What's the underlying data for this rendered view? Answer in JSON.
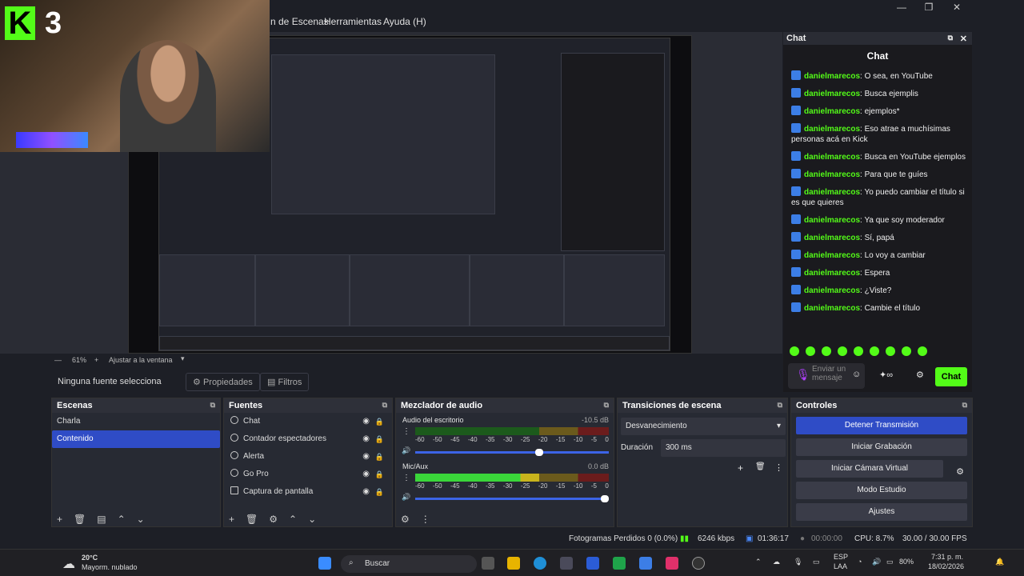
{
  "menubar": {
    "items": [
      "n de Escenas",
      "Herramientas",
      "Ayuda (H)"
    ],
    "minimize": "—",
    "maximize": "❐",
    "close": "✕"
  },
  "webcam": {
    "logo": "K",
    "number": "3"
  },
  "preview": {
    "zoom_minus": "—",
    "zoom_value": "61%",
    "zoom_plus": "+",
    "zoom_fit": "Ajustar a la ventana"
  },
  "source_bar": {
    "no_source": "Ninguna fuente selecciona",
    "properties": "Propiedades",
    "filters": "Filtros"
  },
  "chat": {
    "dock_title": "Chat",
    "title": "Chat",
    "messages": [
      {
        "user": "danielmarecos",
        "text": "O sea, en YouTube"
      },
      {
        "user": "danielmarecos",
        "text": "Busca ejemplis"
      },
      {
        "user": "danielmarecos",
        "text": "ejemplos*"
      },
      {
        "user": "danielmarecos",
        "text": "Eso atrae a muchísimas personas acá en Kick"
      },
      {
        "user": "danielmarecos",
        "text": "Busca en YouTube ejemplos"
      },
      {
        "user": "danielmarecos",
        "text": "Para que te guíes"
      },
      {
        "user": "danielmarecos",
        "text": "Yo puedo cambiar el título si es que quieres"
      },
      {
        "user": "danielmarecos",
        "text": "Ya que soy moderador"
      },
      {
        "user": "danielmarecos",
        "text": "Sí, papá"
      },
      {
        "user": "danielmarecos",
        "text": "Lo voy a cambiar"
      },
      {
        "user": "danielmarecos",
        "text": "Espera"
      },
      {
        "user": "danielmarecos",
        "text": "¿Viste?"
      },
      {
        "user": "danielmarecos",
        "text": "Cambie el título"
      }
    ],
    "input_placeholder": "Enviar un mensaje",
    "send_label": "Chat"
  },
  "scenes": {
    "title": "Escenas",
    "items": [
      "Charla",
      "Contenido"
    ],
    "selected": "Contenido"
  },
  "sources": {
    "title": "Fuentes",
    "items": [
      "Chat",
      "Contador espectadores",
      "Alerta",
      "Go Pro",
      "Captura de pantalla"
    ]
  },
  "mixer": {
    "title": "Mezclador de audio",
    "channels": [
      {
        "name": "Audio del escritorio",
        "db": "-10.5 dB",
        "level": 0.0,
        "volume": 0.66
      },
      {
        "name": "Mic/Aux",
        "db": "0.0 dB",
        "level": 0.64,
        "volume": 1.0
      }
    ],
    "scale": [
      "-60",
      "-50",
      "-45",
      "-40",
      "-35",
      "-30",
      "-25",
      "-20",
      "-15",
      "-10",
      "-5",
      "0"
    ]
  },
  "transitions": {
    "title": "Transiciones de escena",
    "selected": "Desvanecimiento",
    "duration_label": "Duración",
    "duration_value": "300 ms"
  },
  "controls": {
    "title": "Controles",
    "buttons": [
      "Detener Transmisión",
      "Iniciar Grabación",
      "Iniciar Cámara Virtual",
      "Modo Estudio",
      "Ajustes"
    ]
  },
  "status": {
    "dropped": "Fotogramas Perdidos 0 (0.0%)",
    "bitrate": "6246 kbps",
    "stream_time": "01:36:17",
    "rec_time": "00:00:00",
    "cpu": "CPU: 8.7%",
    "fps": "30.00 / 30.00 FPS"
  },
  "taskbar": {
    "weather_temp": "20°C",
    "weather_desc": "Mayorm. nublado",
    "search": "Buscar",
    "lang1": "ESP",
    "lang2": "LAA",
    "battery": "80%",
    "time": "7:31 p. m.",
    "date": "18/02/2026"
  },
  "colors": {
    "kick_green": "#53fc18",
    "obs_blue": "#2f4cc6",
    "panel_bg": "#272a33"
  }
}
